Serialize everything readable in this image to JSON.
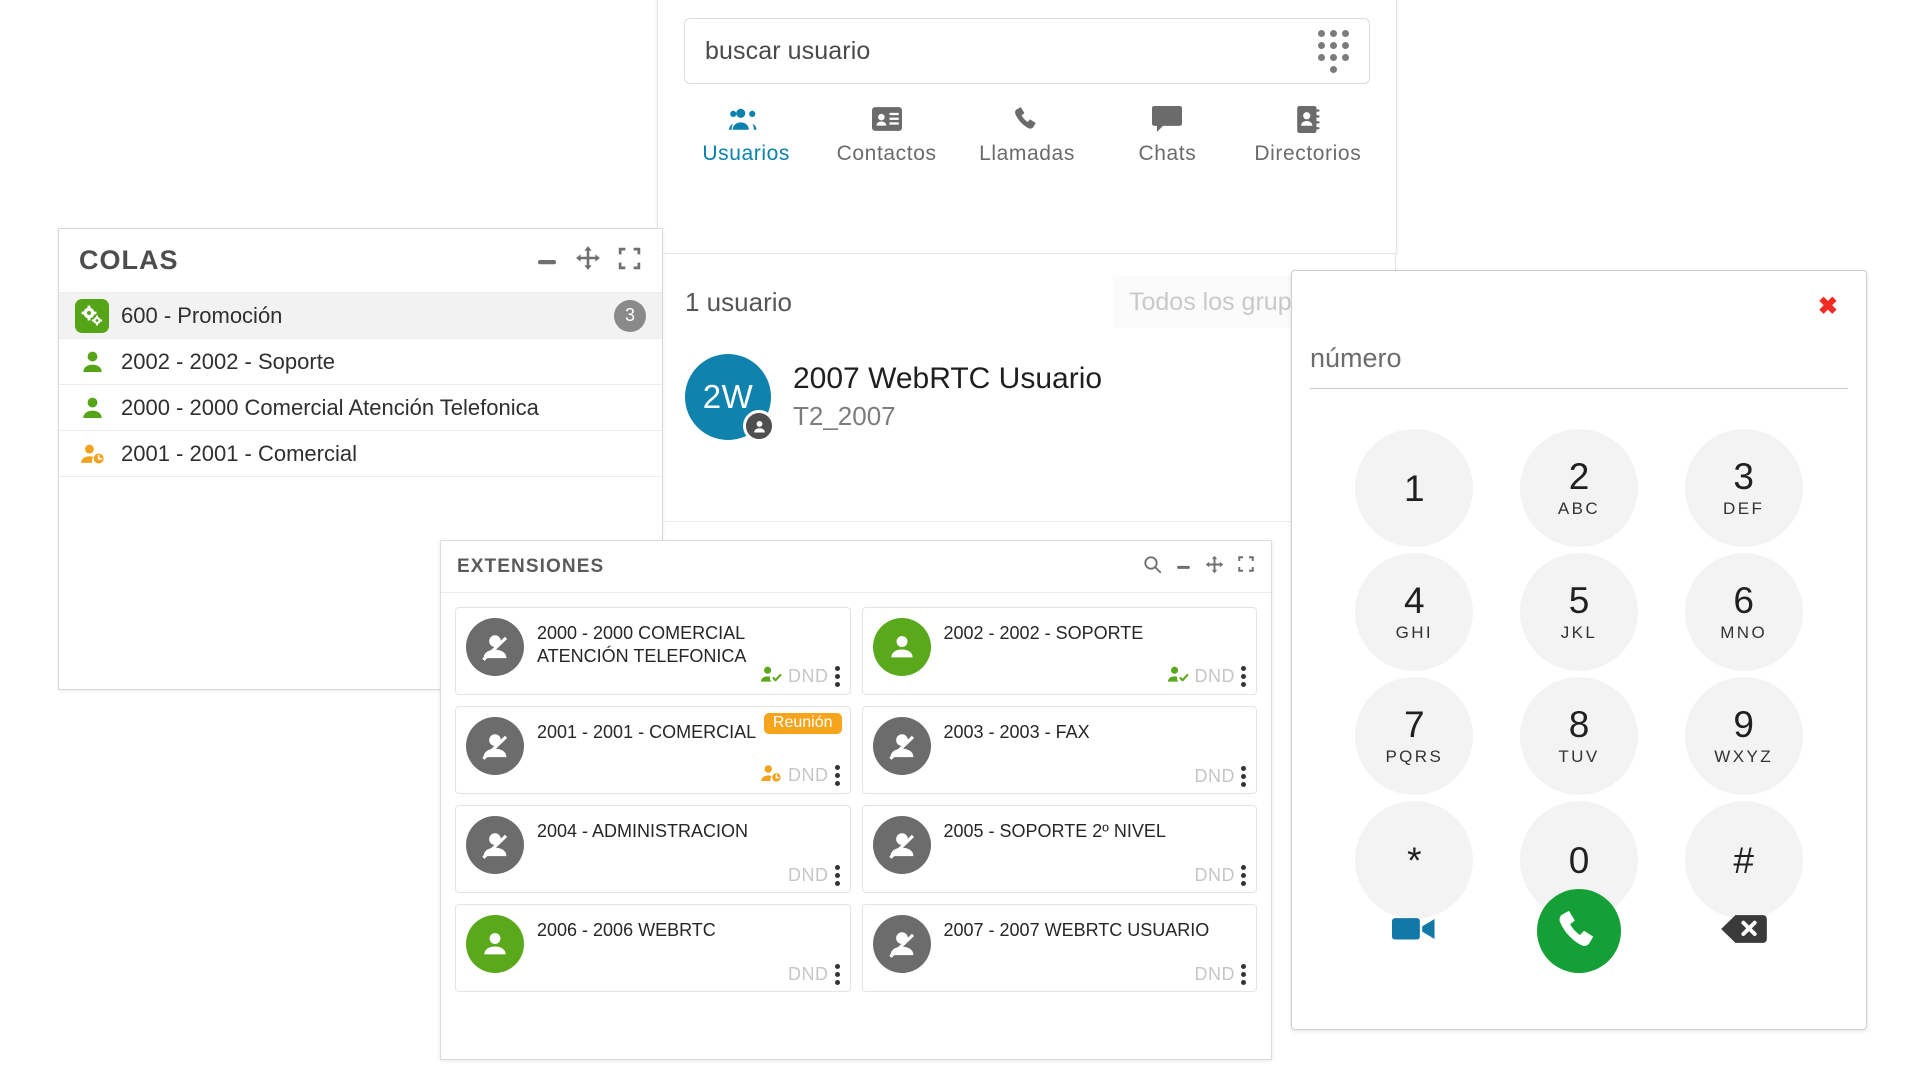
{
  "users_panel": {
    "search": {
      "value": "buscar usuario",
      "dialpad_icon": "dialpad-icon"
    },
    "tabs": [
      {
        "label": "Usuarios",
        "icon": "users-group-icon",
        "active": true
      },
      {
        "label": "Contactos",
        "icon": "contact-card-icon",
        "active": false
      },
      {
        "label": "Llamadas",
        "icon": "phone-icon",
        "active": false
      },
      {
        "label": "Chats",
        "icon": "chat-bubble-icon",
        "active": false
      },
      {
        "label": "Directorios",
        "icon": "address-book-icon",
        "active": false
      }
    ],
    "count_text": "1 usuario",
    "group_filter_placeholder": "Todos los grupos",
    "user": {
      "initials": "2W",
      "name": "2007 WebRTC Usuario",
      "subtitle": "T2_2007",
      "avatar_color": "#0f82ad",
      "status_badge_icon": "person-icon"
    }
  },
  "colas_panel": {
    "title": "COLAS",
    "controls": [
      {
        "name": "minimize-icon",
        "label": "minimizar"
      },
      {
        "name": "move-icon",
        "label": "mover"
      },
      {
        "name": "expand-icon",
        "label": "expandir"
      }
    ],
    "items": [
      {
        "label": "600 - Promoción",
        "icon": "queue-gears-icon",
        "icon_color": "#56a519",
        "badge": "3",
        "selected": true
      },
      {
        "label": "2002 - 2002 - Soporte",
        "icon": "person-icon",
        "icon_color": "#56a519",
        "badge": "",
        "selected": false
      },
      {
        "label": "2000 - 2000 Comercial Atención Telefonica",
        "icon": "person-icon",
        "icon_color": "#56a519",
        "badge": "",
        "selected": false
      },
      {
        "label": "2001 - 2001 - Comercial",
        "icon": "person-clock-icon",
        "icon_color": "#f2a31d",
        "badge": "",
        "selected": false
      }
    ]
  },
  "ext_panel": {
    "title": "EXTENSIONES",
    "controls": [
      {
        "name": "search-icon",
        "label": "buscar"
      },
      {
        "name": "minimize-icon",
        "label": "minimizar"
      },
      {
        "name": "move-icon",
        "label": "mover"
      },
      {
        "name": "expand-icon",
        "label": "expandir"
      }
    ],
    "cards": [
      {
        "name": "2000 - 2000 COMERCIAL ATENCIÓN TELEFONICA",
        "avatar": "person-slash-icon",
        "avatar_state": "off",
        "dnd": "DND",
        "presence_icon": "person-check-icon",
        "presence_color": "#5aa81c",
        "badge": ""
      },
      {
        "name": "2002 - 2002 - SOPORTE",
        "avatar": "person-icon",
        "avatar_state": "on",
        "dnd": "DND",
        "presence_icon": "person-check-icon",
        "presence_color": "#5aa81c",
        "badge": ""
      },
      {
        "name": "2001 - 2001 - COMERCIAL",
        "avatar": "person-slash-icon",
        "avatar_state": "off",
        "dnd": "DND",
        "presence_icon": "person-clock-icon",
        "presence_color": "#f2a31d",
        "badge": "Reunión"
      },
      {
        "name": "2003 - 2003 - FAX",
        "avatar": "person-slash-icon",
        "avatar_state": "off",
        "dnd": "DND",
        "presence_icon": "",
        "presence_color": "",
        "badge": ""
      },
      {
        "name": "2004 - ADMINISTRACION",
        "avatar": "person-slash-icon",
        "avatar_state": "off",
        "dnd": "DND",
        "presence_icon": "",
        "presence_color": "",
        "badge": ""
      },
      {
        "name": "2005 - SOPORTE 2º NIVEL",
        "avatar": "person-slash-icon",
        "avatar_state": "off",
        "dnd": "DND",
        "presence_icon": "",
        "presence_color": "",
        "badge": ""
      },
      {
        "name": "2006 - 2006 WEBRTC",
        "avatar": "person-icon",
        "avatar_state": "on",
        "dnd": "DND",
        "presence_icon": "",
        "presence_color": "",
        "badge": ""
      },
      {
        "name": "2007 - 2007 WEBRTC USUARIO",
        "avatar": "person-slash-icon",
        "avatar_state": "off",
        "dnd": "DND",
        "presence_icon": "",
        "presence_color": "",
        "badge": ""
      }
    ]
  },
  "dial_panel": {
    "close_label": "✖",
    "input_placeholder": "número",
    "keys": [
      {
        "num": "1",
        "letters": ""
      },
      {
        "num": "2",
        "letters": "ABC"
      },
      {
        "num": "3",
        "letters": "DEF"
      },
      {
        "num": "4",
        "letters": "GHI"
      },
      {
        "num": "5",
        "letters": "JKL"
      },
      {
        "num": "6",
        "letters": "MNO"
      },
      {
        "num": "7",
        "letters": "PQRS"
      },
      {
        "num": "8",
        "letters": "TUV"
      },
      {
        "num": "9",
        "letters": "WXYZ"
      },
      {
        "num": "*",
        "letters": ""
      },
      {
        "num": "0",
        "letters": ""
      },
      {
        "num": "#",
        "letters": ""
      }
    ],
    "actions": [
      {
        "name": "video-call-button",
        "icon": "video-camera-icon",
        "color": "#1178a8"
      },
      {
        "name": "call-button",
        "icon": "phone-icon",
        "color": "#14a037"
      },
      {
        "name": "backspace-button",
        "icon": "backspace-icon",
        "color": "#3a3a3a"
      }
    ]
  },
  "colors": {
    "accent_blue": "#0b81ad",
    "green": "#56a519",
    "orange": "#f2a31d",
    "red": "#ef2b24",
    "call_green": "#14a037"
  }
}
